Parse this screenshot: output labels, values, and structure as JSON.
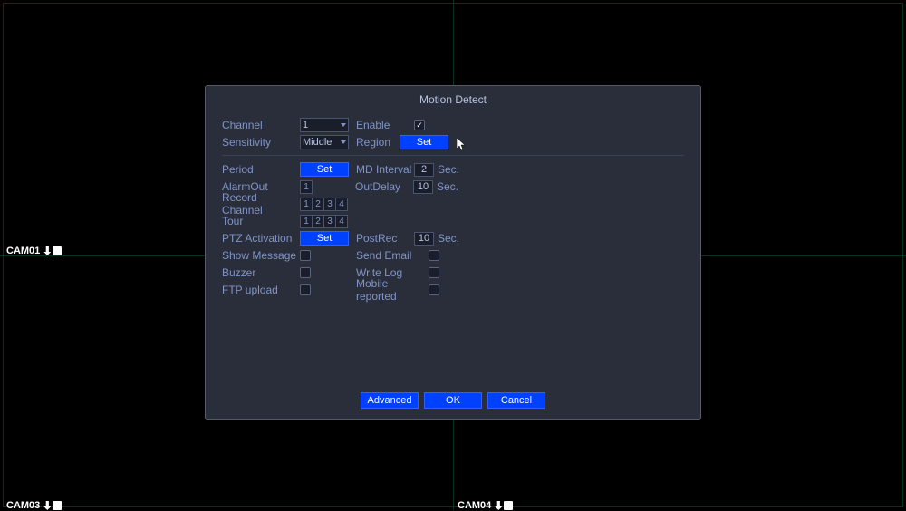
{
  "cameras": {
    "cam1": "CAM01",
    "cam3": "CAM03",
    "cam4": "CAM04"
  },
  "dialog": {
    "title": "Motion Detect",
    "channel_label": "Channel",
    "channel_value": "1",
    "enable_label": "Enable",
    "enable_checked": "✓",
    "sensitivity_label": "Sensitivity",
    "sensitivity_value": "Middle",
    "region_label": "Region",
    "region_btn": "Set",
    "period_label": "Period",
    "period_btn": "Set",
    "md_interval_label": "MD Interval",
    "md_interval_value": "2",
    "sec": "Sec.",
    "alarmout_label": "AlarmOut",
    "outdelay_label": "OutDelay",
    "outdelay_value": "10",
    "record_channel_label": "Record Channel",
    "tour_label": "Tour",
    "ptz_label": "PTZ Activation",
    "ptz_btn": "Set",
    "postrec_label": "PostRec",
    "postrec_value": "10",
    "show_message_label": "Show Message",
    "send_email_label": "Send Email",
    "buzzer_label": "Buzzer",
    "write_log_label": "Write Log",
    "ftp_label": "FTP upload",
    "mobile_label": "Mobile reported",
    "channels": [
      "1",
      "2",
      "3",
      "4"
    ],
    "alarm_channels": [
      "1"
    ],
    "footer": {
      "advanced": "Advanced",
      "ok": "OK",
      "cancel": "Cancel"
    }
  }
}
